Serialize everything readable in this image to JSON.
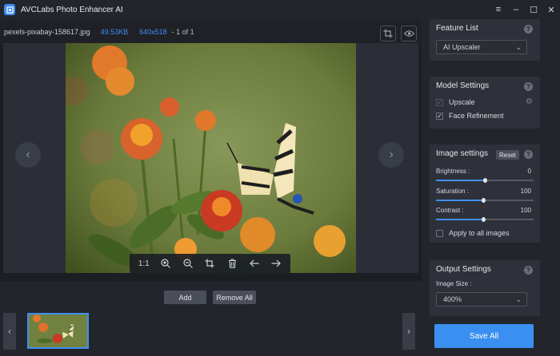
{
  "app": {
    "title": "AVCLabs Photo Enhancer AI"
  },
  "window_controls": {
    "menu": "≡",
    "minimize": "–",
    "maximize": "☐",
    "close": "✕"
  },
  "file_info": {
    "name": "pexels-pixabay-158617.jpg",
    "size": "49.53KB",
    "dimensions": "640x518",
    "count": "- 1 of 1"
  },
  "image_toolbar": {
    "ratio_label": "1:1",
    "icons": [
      "zoom-in-icon",
      "zoom-out-icon",
      "crop-icon",
      "trash-icon",
      "arrow-left-icon",
      "arrow-right-icon"
    ]
  },
  "actions": {
    "add_label": "Add",
    "remove_all_label": "Remove All",
    "save_all_label": "Save All"
  },
  "feature_list": {
    "title": "Feature List",
    "selected": "AI Upscaler"
  },
  "model_settings": {
    "title": "Model Settings",
    "items": [
      {
        "label": "Upscale",
        "checked": true,
        "disabled": true
      },
      {
        "label": "Face Refinement",
        "checked": true,
        "disabled": false
      }
    ]
  },
  "image_settings": {
    "title": "Image settings",
    "reset_label": "Reset",
    "sliders": [
      {
        "label": "Brightness :",
        "value": "0",
        "fraction": 0.5
      },
      {
        "label": "Saturation :",
        "value": "100",
        "fraction": 0.48
      },
      {
        "label": "Contrast :",
        "value": "100",
        "fraction": 0.48
      }
    ],
    "apply_all_label": "Apply to all images",
    "apply_all_checked": false
  },
  "output_settings": {
    "title": "Output Settings",
    "size_label": "Image Size :",
    "size_value": "400%"
  },
  "colors": {
    "accent": "#3f8ff0",
    "panel": "#2e3139",
    "background": "#1c1e24"
  }
}
